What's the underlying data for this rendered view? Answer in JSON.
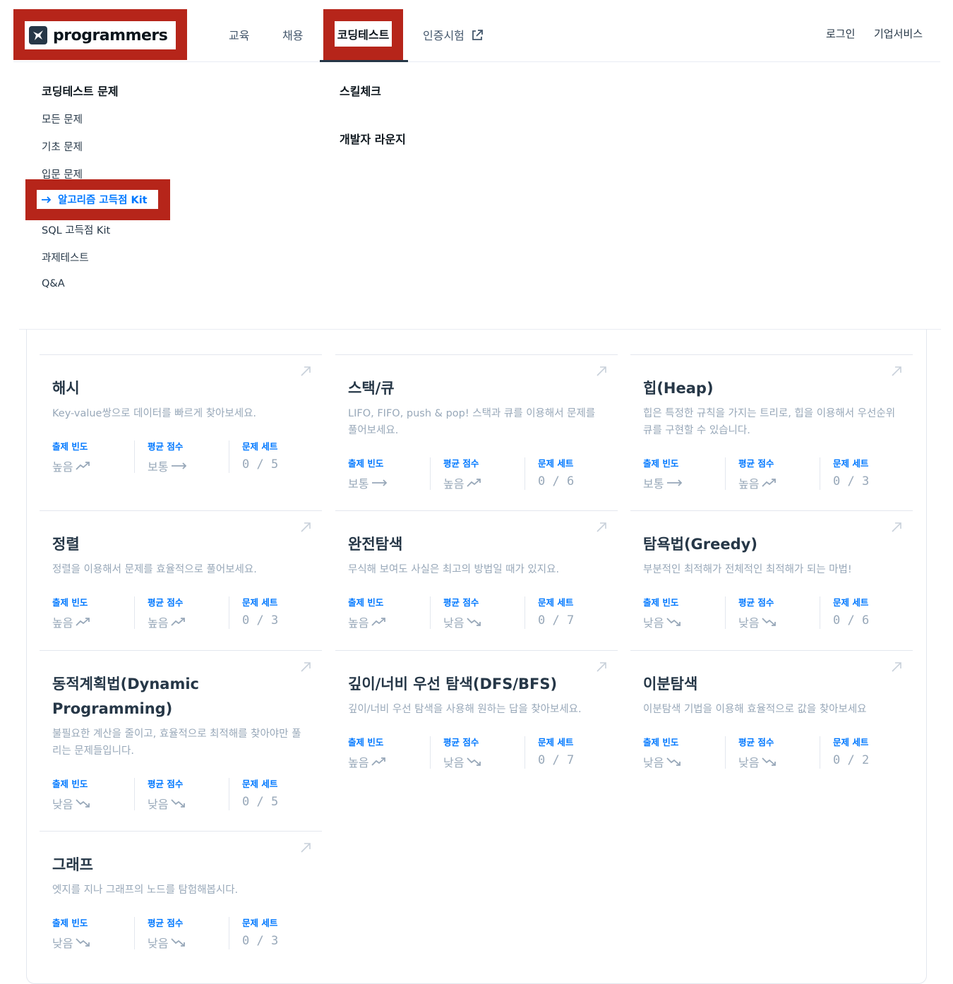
{
  "brand": {
    "name": "programmers",
    "logo_icon": "programmers-logo-icon"
  },
  "nav": {
    "education": "교육",
    "jobs": "채용",
    "coding_test": "코딩테스트",
    "certification": "인증시험",
    "login": "로그인",
    "enterprise": "기업서비스"
  },
  "menu": {
    "col1_title": "코딩테스트 문제",
    "items": [
      "모든 문제",
      "기초 문제",
      "입문 문제",
      "알고리즘 고득점 Kit",
      "SQL 고득점 Kit",
      "과제테스트",
      "Q&A"
    ],
    "active_index": 3,
    "skill_check": "스킬체크",
    "dev_lounge": "개발자 라운지"
  },
  "stat_labels": {
    "frequency": "출제 빈도",
    "avg_score": "평균 점수",
    "problem_set": "문제 세트"
  },
  "colors": {
    "accent": "#0078ff",
    "highlight": "#b6251a",
    "muted": "#98a8b9",
    "title": "#263747"
  },
  "cards": [
    {
      "title": "해시",
      "desc": "Key-value쌍으로 데이터를 빠르게 찾아보세요.",
      "frequency": "높음",
      "frequency_trend": "up",
      "score": "보통",
      "score_trend": "flat",
      "set": "0 / 5"
    },
    {
      "title": "스택/큐",
      "desc": "LIFO, FIFO, push & pop! 스택과 큐를 이용해서 문제를 풀어보세요.",
      "frequency": "보통",
      "frequency_trend": "flat",
      "score": "높음",
      "score_trend": "up",
      "set": "0 / 6"
    },
    {
      "title": "힙(Heap)",
      "desc": "힙은 특정한 규칙을 가지는 트리로, 힙을 이용해서 우선순위 큐를 구현할 수 있습니다.",
      "frequency": "보통",
      "frequency_trend": "flat",
      "score": "높음",
      "score_trend": "up",
      "set": "0 / 3"
    },
    {
      "title": "정렬",
      "desc": "정렬을 이용해서 문제를 효율적으로 풀어보세요.",
      "frequency": "높음",
      "frequency_trend": "up",
      "score": "높음",
      "score_trend": "up",
      "set": "0 / 3"
    },
    {
      "title": "완전탐색",
      "desc": "무식해 보여도 사실은 최고의 방법일 때가 있지요.",
      "frequency": "높음",
      "frequency_trend": "up",
      "score": "낮음",
      "score_trend": "down",
      "set": "0 / 7"
    },
    {
      "title": "탐욕법(Greedy)",
      "desc": "부분적인 최적해가 전체적인 최적해가 되는 마법!",
      "frequency": "낮음",
      "frequency_trend": "down",
      "score": "낮음",
      "score_trend": "down",
      "set": "0 / 6"
    },
    {
      "title": "동적계획법(Dynamic Programming)",
      "desc": "불필요한 계산을 줄이고, 효율적으로 최적해를 찾아야만 풀리는 문제들입니다.",
      "frequency": "낮음",
      "frequency_trend": "down",
      "score": "낮음",
      "score_trend": "down",
      "set": "0 / 5"
    },
    {
      "title": "깊이/너비 우선 탐색(DFS/BFS)",
      "desc": "깊이/너비 우선 탐색을 사용해 원하는 답을 찾아보세요.",
      "frequency": "높음",
      "frequency_trend": "up",
      "score": "낮음",
      "score_trend": "down",
      "set": "0 / 7"
    },
    {
      "title": "이분탐색",
      "desc": "이분탐색 기법을 이용해 효율적으로 값을 찾아보세요",
      "frequency": "낮음",
      "frequency_trend": "down",
      "score": "낮음",
      "score_trend": "down",
      "set": "0 / 2"
    },
    {
      "title": "그래프",
      "desc": "엣지를 지나 그래프의 노드를 탐험해봅시다.",
      "frequency": "낮음",
      "frequency_trend": "down",
      "score": "낮음",
      "score_trend": "down",
      "set": "0 / 3"
    }
  ]
}
